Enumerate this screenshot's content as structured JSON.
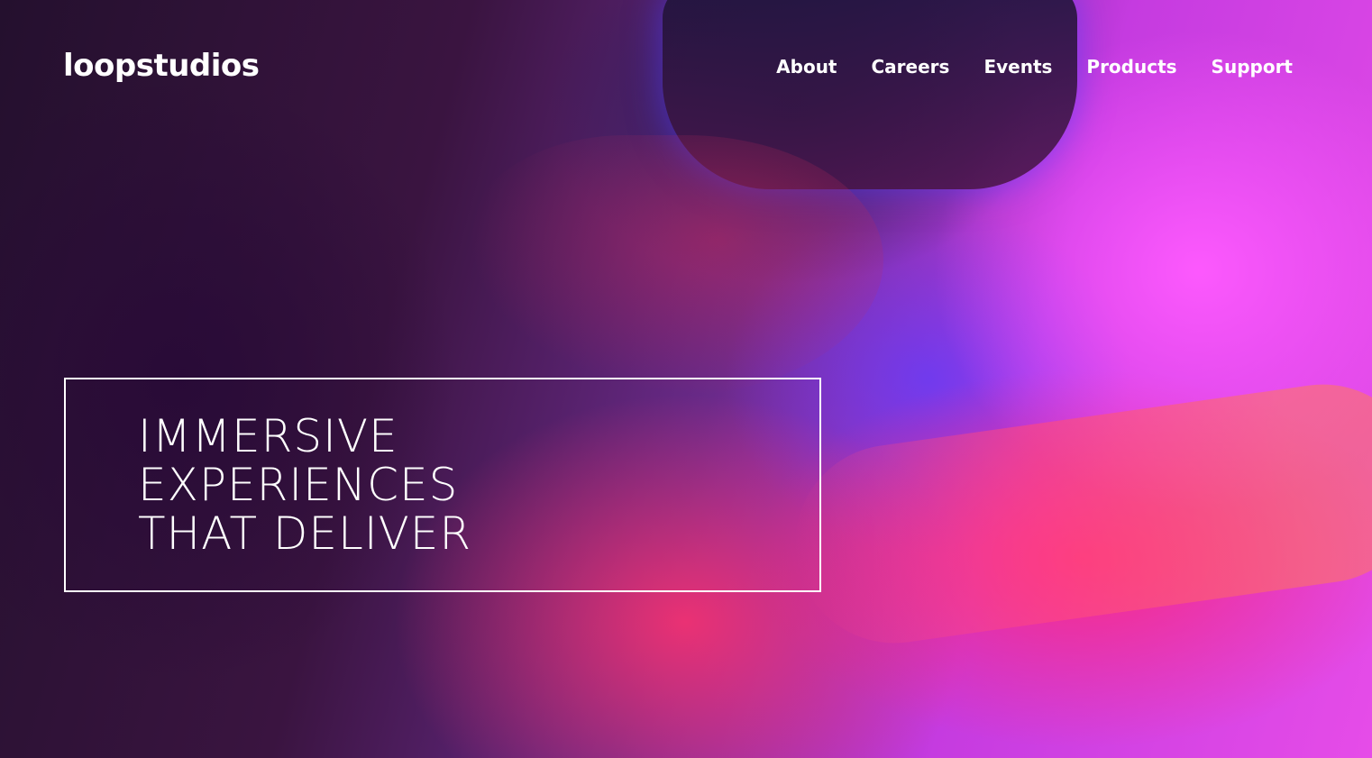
{
  "brand": {
    "logo_text": "loopstudios"
  },
  "nav": {
    "items": [
      {
        "label": "About"
      },
      {
        "label": "Careers"
      },
      {
        "label": "Events"
      },
      {
        "label": "Products"
      },
      {
        "label": "Support"
      }
    ]
  },
  "hero": {
    "headline_lines": [
      "IMMERSIVE",
      "EXPERIENCES",
      "THAT DELIVER"
    ]
  },
  "colors": {
    "text": "#ffffff",
    "accent_magenta": "#e64ce8",
    "accent_red": "#ff2878",
    "background_dark": "#24102e"
  }
}
